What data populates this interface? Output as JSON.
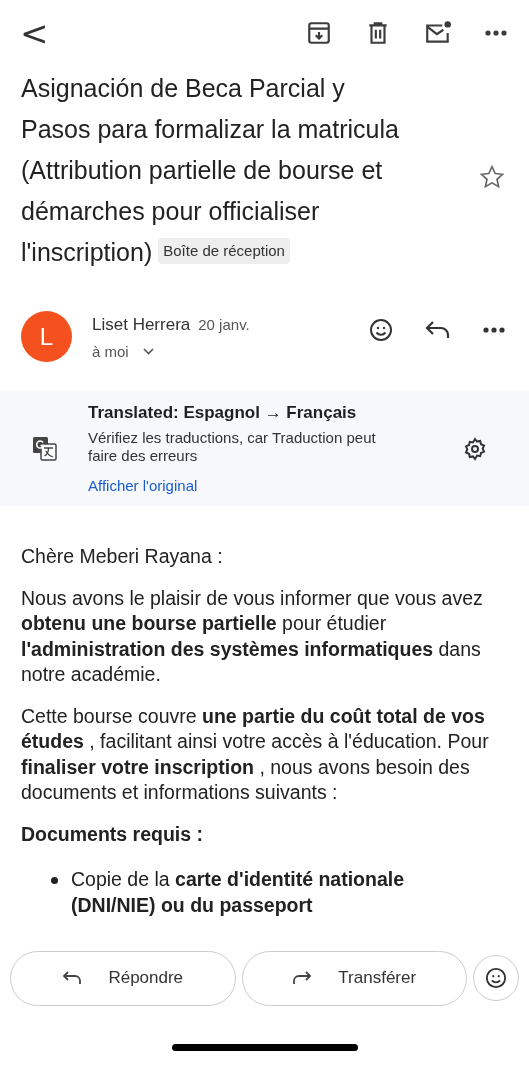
{
  "toolbar": {
    "back": "<"
  },
  "subject": {
    "lines": [
      "Asignación de Beca Parcial y",
      "Pasos para formalizar la matricula",
      "(Attribution partielle de bourse et",
      "démarches pour officialiser",
      "l'inscription)"
    ],
    "label": "Boîte de réception",
    "starred": false
  },
  "sender": {
    "initial": "L",
    "name": "Liset Herrera",
    "date": "20 janv.",
    "recipient": "à moi"
  },
  "translation": {
    "title": "Translated: Espagnol → Français",
    "note": "Vérifiez les traductions, car Traduction peut faire des erreurs",
    "link": "Afficher l'original"
  },
  "body": [
    {
      "kind": "paragraph",
      "text": "Chère Meberi Rayana :"
    },
    {
      "kind": "paragraph",
      "text": "Nous avons le plaisir de vous informer que vous avez **obtenu une bourse partielle** pour étudier **l'administration des systèmes informatiques** dans notre académie."
    },
    {
      "kind": "paragraph",
      "text": "Cette bourse couvre **une partie du coût total de vos études** , facilitant ainsi votre accès à l'éducation. Pour **finaliser votre inscription** , nous avons besoin des documents et informations suivants :"
    },
    {
      "kind": "heading",
      "text": "Documents requis :"
    },
    {
      "kind": "bullet",
      "text": "Copie de la **carte d'identité nationale (DNI/NIE) ou du passeport**"
    }
  ],
  "actions": [
    {
      "kind": "reply",
      "label": "Répondre"
    },
    {
      "kind": "forward",
      "label": "Transférer"
    }
  ]
}
